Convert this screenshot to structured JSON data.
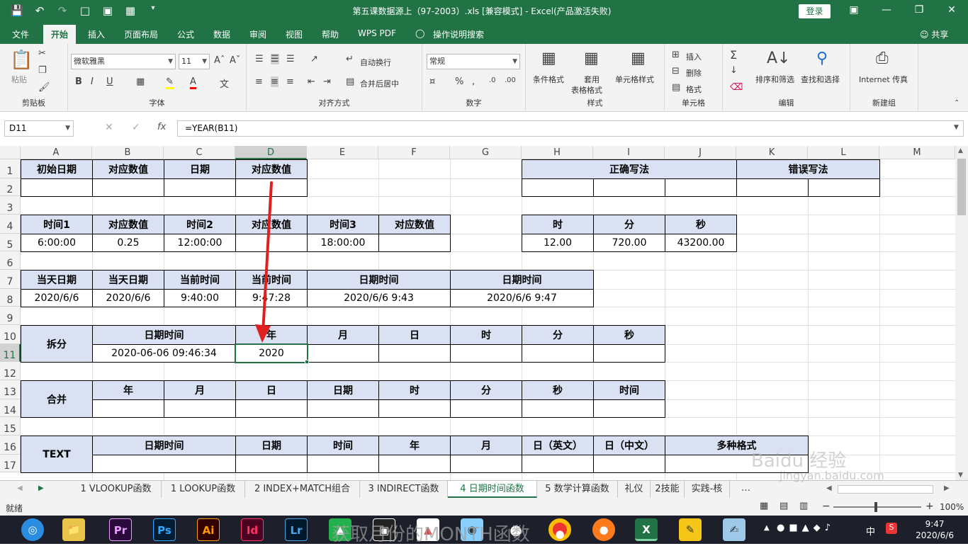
{
  "app": {
    "title": "第五课数据源上（97-2003）.xls  [兼容模式]  -  Excel(产品激活失败)",
    "login": "登录"
  },
  "tabs": [
    "文件",
    "开始",
    "插入",
    "页面布局",
    "公式",
    "数据",
    "审阅",
    "视图",
    "帮助",
    "WPS PDF",
    "操作说明搜索"
  ],
  "share": "共享",
  "ribbon": {
    "paste": "粘贴",
    "clipboard": "剪贴板",
    "font_name": "微软雅黑",
    "font_size": "11",
    "font_group": "字体",
    "wrap_text": "自动换行",
    "merge_center": "合并后居中",
    "align_group": "对齐方式",
    "number_format": "常规",
    "number_group": "数字",
    "cond_format": "条件格式",
    "table_format_1": "套用",
    "table_format_2": "表格格式",
    "cell_styles": "单元格样式",
    "styles_group": "样式",
    "insert": "插入",
    "delete": "删除",
    "format": "格式",
    "cells_group": "单元格",
    "sort_filter": "排序和筛选",
    "find_select": "查找和选择",
    "edit_group": "编辑",
    "internet_fax": "Internet 传真",
    "new_group": "新建组"
  },
  "formula_bar": {
    "name_box": "D11",
    "formula": "=YEAR(B11)",
    "fx": "fx"
  },
  "columns": [
    "A",
    "B",
    "C",
    "D",
    "E",
    "F",
    "G",
    "H",
    "I",
    "J",
    "K",
    "L",
    "M"
  ],
  "rows": [
    "1",
    "2",
    "3",
    "4",
    "5",
    "6",
    "7",
    "8",
    "9",
    "10",
    "11",
    "12",
    "13",
    "14",
    "15",
    "16",
    "17"
  ],
  "cells": {
    "a1": "初始日期",
    "b1": "对应数值",
    "c1": "日期",
    "d1": "对应数值",
    "h1": "正确写法",
    "k1": "错误写法",
    "a4": "时间1",
    "b4": "对应数值",
    "c4": "时间2",
    "d4": "对应数值",
    "e4": "时间3",
    "f4": "对应数值",
    "h4": "时",
    "i4": "分",
    "j4": "秒",
    "a5": "6:00:00",
    "b5": "0.25",
    "c5": "12:00:00",
    "e5": "18:00:00",
    "h5": "12.00",
    "i5": "720.00",
    "j5": "43200.00",
    "a7": "当天日期",
    "b7": "当天日期",
    "c7": "当前时间",
    "d7": "当前时间",
    "e7": "日期时间",
    "g7": "日期时间",
    "a8": "2020/6/6",
    "b8": "2020/6/6",
    "c8": "9:40:00",
    "d8": "9:47:28",
    "e8": "2020/6/6 9:43",
    "g8": "2020/6/6 9:47",
    "a10": "拆分",
    "b10": "日期时间",
    "d10": "年",
    "e10": "月",
    "f10": "日",
    "g10": "时",
    "h10": "分",
    "i10": "秒",
    "b11": "2020-06-06 09:46:34",
    "d11": "2020",
    "a13": "合并",
    "b13": "年",
    "c13": "月",
    "d13": "日",
    "e13": "日期",
    "f13": "时",
    "g13": "分",
    "h13": "秒",
    "i13": "时间",
    "a16": "TEXT",
    "b16": "日期时间",
    "d16": "日期",
    "e16": "时间",
    "f16": "年",
    "g16": "月",
    "h16": "日（英文）",
    "i16": "日（中文）",
    "j16": "多种格式"
  },
  "sheet_tabs": [
    "1 VLOOKUP函数",
    "1 LOOKUP函数",
    "2 INDEX+MATCH组合",
    "3 INDIRECT函数",
    "4 日期时间函数",
    "5 数学计算函数",
    "礼仪",
    "2技能",
    "实践-核"
  ],
  "active_sheet": "4 日期时间函数",
  "status": {
    "ready": "就绪",
    "zoom": "100%"
  },
  "taskbar": {
    "apps": [
      "Pr",
      "Ps",
      "Ai",
      "Id",
      "Lr"
    ],
    "time": "9:47",
    "date": "2020/6/6",
    "ime": "中"
  },
  "watermark": "Baidu 经验",
  "watermark_url": "jingyan.baidu.com",
  "caption": "获取月份的MONTH函数",
  "colors": {
    "excel_green": "#217346",
    "header_fill": "#d9e1f2",
    "arrow": "#e02020"
  }
}
